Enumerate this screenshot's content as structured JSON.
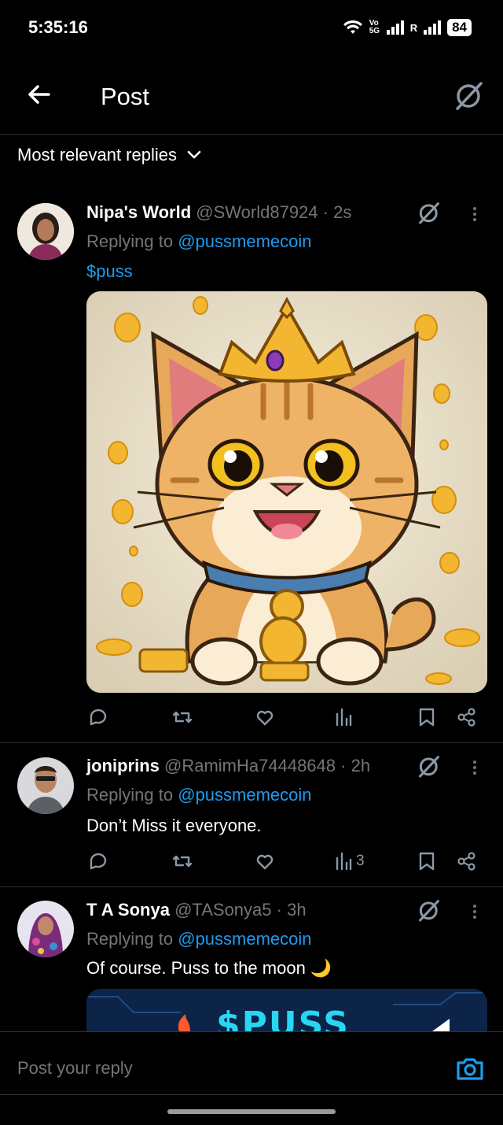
{
  "status_bar": {
    "time": "5:35:16",
    "network_label": "Vo 5G",
    "roaming_label": "R",
    "battery": "84"
  },
  "header": {
    "title": "Post"
  },
  "sort": {
    "label": "Most relevant replies"
  },
  "replies": [
    {
      "name": "Nipa's World",
      "handle": "@SWorld87924",
      "time": "· 2s",
      "replying_prefix": "Replying to",
      "replying_to": "@pussmemecoin",
      "text": "$puss",
      "views": ""
    },
    {
      "name": "joniprins",
      "handle": "@RamimHa74448648",
      "time": "· 2h",
      "replying_prefix": "Replying to",
      "replying_to": "@pussmemecoin",
      "text": "Don’t Miss it everyone.",
      "views": "3"
    },
    {
      "name": "T A Sonya",
      "handle": "@TASonya5",
      "time": "· 3h",
      "replying_prefix": "Replying to",
      "replying_to": "@pussmemecoin",
      "text": "Of course. Puss to the moon 🌙",
      "media_text": "$PUSS"
    }
  ],
  "composer": {
    "placeholder": "Post your reply"
  },
  "colors": {
    "accent": "#1d9bf0",
    "muted": "#71767b",
    "background": "#000000"
  }
}
